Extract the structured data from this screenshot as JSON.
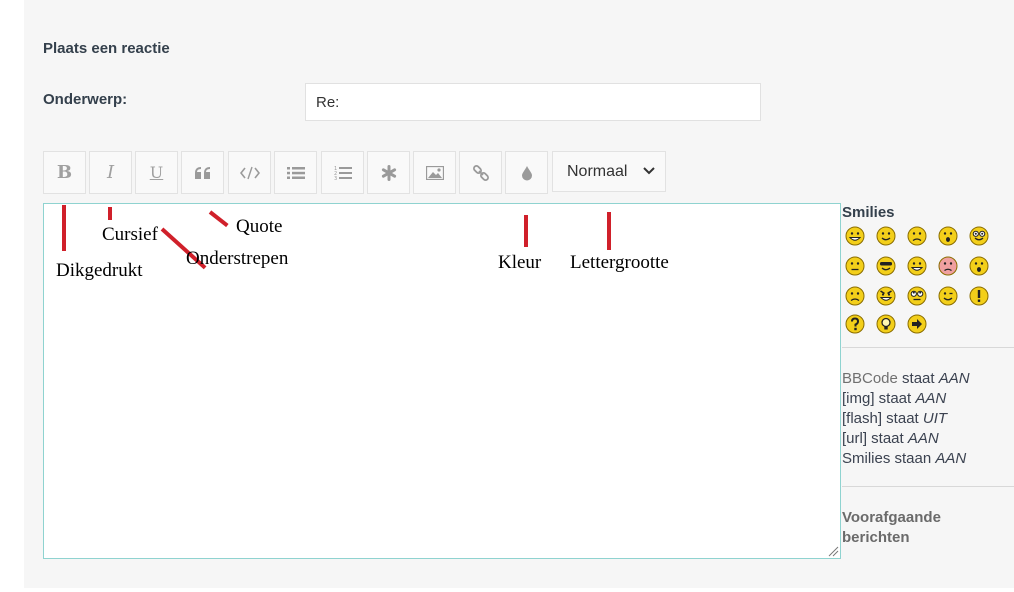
{
  "form": {
    "heading": "Plaats een reactie",
    "subject_label": "Onderwerp:",
    "subject_value": "Re:"
  },
  "toolbar": {
    "buttons": [
      {
        "name": "bold",
        "glyph": "B"
      },
      {
        "name": "italic",
        "glyph": "I"
      },
      {
        "name": "underline",
        "glyph": "U"
      },
      {
        "name": "quote",
        "icon": "quote-icon"
      },
      {
        "name": "code",
        "icon": "code-icon"
      },
      {
        "name": "list",
        "icon": "list-icon"
      },
      {
        "name": "ordered-list",
        "icon": "ordered-list-icon"
      },
      {
        "name": "list-item",
        "icon": "asterisk-icon"
      },
      {
        "name": "image",
        "icon": "image-icon"
      },
      {
        "name": "link",
        "icon": "link-icon"
      },
      {
        "name": "color",
        "icon": "droplet-icon"
      }
    ],
    "size_select": "Normaal"
  },
  "annotations": {
    "dikgedrukt": "Dikgedrukt",
    "cursief": "Cursief",
    "onderstrepen": "Onderstrepen",
    "quote": "Quote",
    "kleur": "Kleur",
    "lettergrootte": "Lettergrootte"
  },
  "sidebar": {
    "smilies_title": "Smilies",
    "bbcode": {
      "bbcode_label": "BBCode",
      "bbcode_text": " staat ",
      "bbcode_status": "AAN",
      "img_label": "[img] staat ",
      "img_status": "AAN",
      "flash_label": "[flash] staat ",
      "flash_status": "UIT",
      "url_label": "[url] staat ",
      "url_status": "AAN",
      "smilies_label": "Smilies staan ",
      "smilies_status": "AAN"
    },
    "previous_posts": "Voorafgaande berichten"
  },
  "colors": {
    "accent_border": "#8fd3d0",
    "annotation_red": "#d0202a",
    "smiley_yellow": "#f3cf1a"
  }
}
